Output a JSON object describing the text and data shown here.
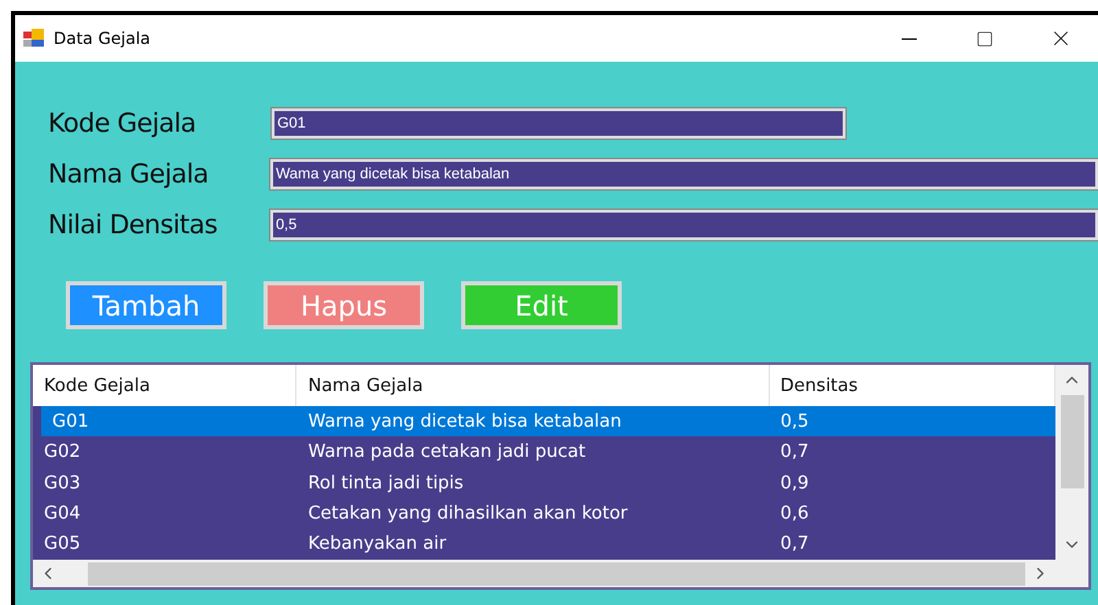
{
  "window": {
    "title": "Data Gejala"
  },
  "form": {
    "fields": [
      {
        "label": "Kode Gejala",
        "value": "G01",
        "short": true
      },
      {
        "label": "Nama Gejala",
        "value": "Wama yang dicetak bisa ketabalan",
        "short": false
      },
      {
        "label": "Nilai Densitas",
        "value": "0,5",
        "short": false
      }
    ]
  },
  "buttons": [
    {
      "label": "Tambah",
      "color": "#1e90ff"
    },
    {
      "label": "Hapus",
      "color": "#f08080"
    },
    {
      "label": "Edit",
      "color": "#32cd32"
    }
  ],
  "table": {
    "columns": [
      "Kode Gejala",
      "Nama Gejala",
      "Densitas"
    ],
    "rows": [
      {
        "cells": [
          "G01",
          "Warna yang dicetak bisa ketabalan",
          "0,5"
        ],
        "selected": true
      },
      {
        "cells": [
          "G02",
          "Warna pada cetakan jadi pucat",
          "0,7"
        ],
        "selected": false
      },
      {
        "cells": [
          "G03",
          "Rol tinta jadi tipis",
          "0,9"
        ],
        "selected": false
      },
      {
        "cells": [
          "G04",
          "Cetakan yang dihasilkan akan kotor",
          "0,6"
        ],
        "selected": false
      },
      {
        "cells": [
          "G05",
          "Kebanyakan air",
          "0,7"
        ],
        "selected": false
      }
    ]
  }
}
